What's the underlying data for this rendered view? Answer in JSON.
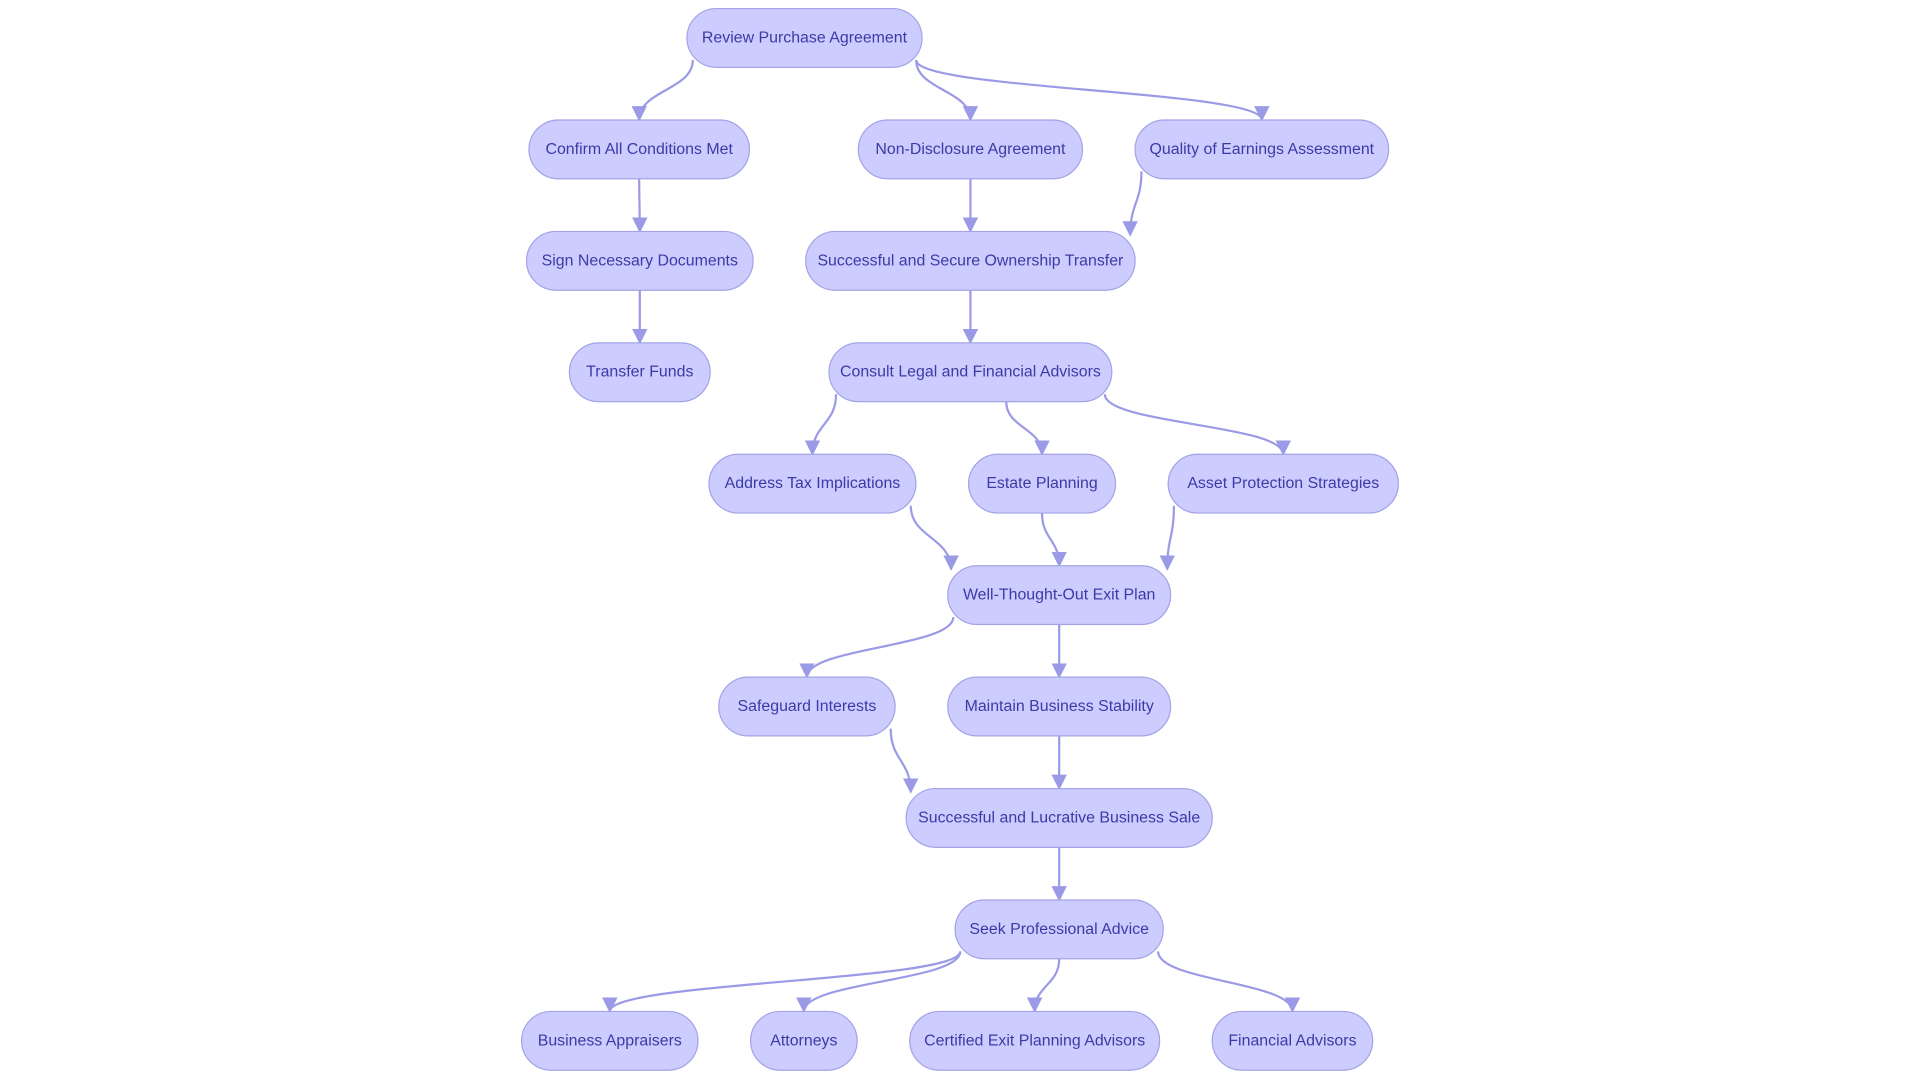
{
  "diagram": {
    "type": "flowchart",
    "colors": {
      "node_fill": "#ccccff",
      "node_stroke": "#a3a3e6",
      "edge": "#9a9ae6",
      "text": "#3b3ba6"
    },
    "nodes": [
      {
        "id": "n1",
        "label": "Review Purchase Agreement"
      },
      {
        "id": "n2",
        "label": "Confirm All Conditions Met"
      },
      {
        "id": "n3",
        "label": "Non-Disclosure Agreement"
      },
      {
        "id": "n4",
        "label": "Quality of Earnings Assessment"
      },
      {
        "id": "n5",
        "label": "Sign Necessary Documents"
      },
      {
        "id": "n6",
        "label": "Successful and Secure Ownership Transfer"
      },
      {
        "id": "n7",
        "label": "Transfer Funds"
      },
      {
        "id": "n8",
        "label": "Consult Legal and Financial Advisors"
      },
      {
        "id": "n9",
        "label": "Address Tax Implications"
      },
      {
        "id": "n10",
        "label": "Estate Planning"
      },
      {
        "id": "n11",
        "label": "Asset Protection Strategies"
      },
      {
        "id": "n12",
        "label": "Well-Thought-Out Exit Plan"
      },
      {
        "id": "n13",
        "label": "Safeguard Interests"
      },
      {
        "id": "n14",
        "label": "Maintain Business Stability"
      },
      {
        "id": "n15",
        "label": "Successful and Lucrative Business Sale"
      },
      {
        "id": "n16",
        "label": "Seek Professional Advice"
      },
      {
        "id": "n17",
        "label": "Business Appraisers"
      },
      {
        "id": "n18",
        "label": "Attorneys"
      },
      {
        "id": "n19",
        "label": "Certified Exit Planning Advisors"
      },
      {
        "id": "n20",
        "label": "Financial Advisors"
      }
    ],
    "edges": [
      [
        "n1",
        "n2"
      ],
      [
        "n1",
        "n3"
      ],
      [
        "n1",
        "n4"
      ],
      [
        "n2",
        "n5"
      ],
      [
        "n5",
        "n7"
      ],
      [
        "n3",
        "n6"
      ],
      [
        "n4",
        "n6"
      ],
      [
        "n6",
        "n8"
      ],
      [
        "n8",
        "n9"
      ],
      [
        "n8",
        "n10"
      ],
      [
        "n8",
        "n11"
      ],
      [
        "n9",
        "n12"
      ],
      [
        "n10",
        "n12"
      ],
      [
        "n11",
        "n12"
      ],
      [
        "n12",
        "n13"
      ],
      [
        "n12",
        "n14"
      ],
      [
        "n13",
        "n15"
      ],
      [
        "n14",
        "n15"
      ],
      [
        "n15",
        "n16"
      ],
      [
        "n16",
        "n17"
      ],
      [
        "n16",
        "n18"
      ],
      [
        "n16",
        "n19"
      ],
      [
        "n16",
        "n20"
      ]
    ]
  }
}
